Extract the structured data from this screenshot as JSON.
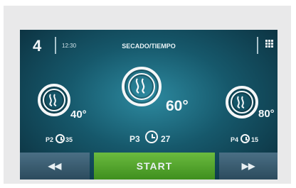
{
  "header": {
    "number": "4",
    "time": "12:30",
    "title": "SECADO/TIEMPO"
  },
  "programs": [
    {
      "temp": "40°",
      "label": "P2",
      "minutes": "35"
    },
    {
      "temp": "60°",
      "label": "P3",
      "minutes": "27"
    },
    {
      "temp": "80°",
      "label": "P4",
      "minutes": "15"
    }
  ],
  "controls": {
    "prev": "◀◀",
    "start": "START",
    "next": "▶▶"
  },
  "icons": {
    "menu": "grid-icon",
    "program": "steam-icon",
    "timer": "clock-icon"
  },
  "colors": {
    "start": "#56a92f",
    "screen": "#16586b"
  }
}
